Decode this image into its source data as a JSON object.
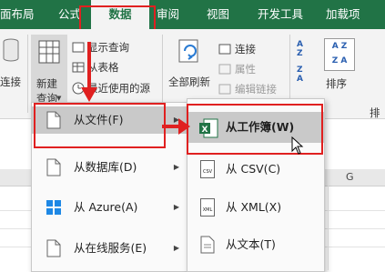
{
  "tabs": [
    {
      "label": "面布局",
      "active": false
    },
    {
      "label": "公式",
      "active": false
    },
    {
      "label": "数据",
      "active": true
    },
    {
      "label": "审阅",
      "active": false
    },
    {
      "label": "视图",
      "active": false
    },
    {
      "label": "开发工具",
      "active": false
    },
    {
      "label": "加载项",
      "active": false
    }
  ],
  "ribbon": {
    "connect_fragment": "连接",
    "new_query_line1": "新建",
    "new_query_line2": "查询",
    "show_queries": "显示查询",
    "from_table": "从表格",
    "recent_sources": "最近使用的源",
    "refresh_all": "全部刷新",
    "connections": "连接",
    "properties": "属性",
    "edit_links": "编辑链接",
    "sort": "排序",
    "group_fragment": "排"
  },
  "grid": {
    "column_header": "G"
  },
  "menu_main": {
    "items": [
      {
        "label": "从文件(F)",
        "highlight": true
      },
      {
        "label": "从数据库(D)",
        "highlight": false
      },
      {
        "label": "从 Azure(A)",
        "highlight": false
      },
      {
        "label": "从在线服务(E)",
        "highlight": false
      }
    ]
  },
  "menu_sub": {
    "items": [
      {
        "label": "从工作簿(W)",
        "highlight": true
      },
      {
        "label": "从 CSV(C)",
        "highlight": false
      },
      {
        "label": "从 XML(X)",
        "highlight": false
      },
      {
        "label": "从文本(T)",
        "highlight": false
      }
    ]
  },
  "icon_text": {
    "csv": "CSV",
    "xml": "XML",
    "sort_az": "A Z",
    "sort_za": "Z A"
  },
  "colors": {
    "brand_green": "#217346",
    "annotation_red": "#e02020",
    "highlight_gray": "#c9c9c9"
  }
}
